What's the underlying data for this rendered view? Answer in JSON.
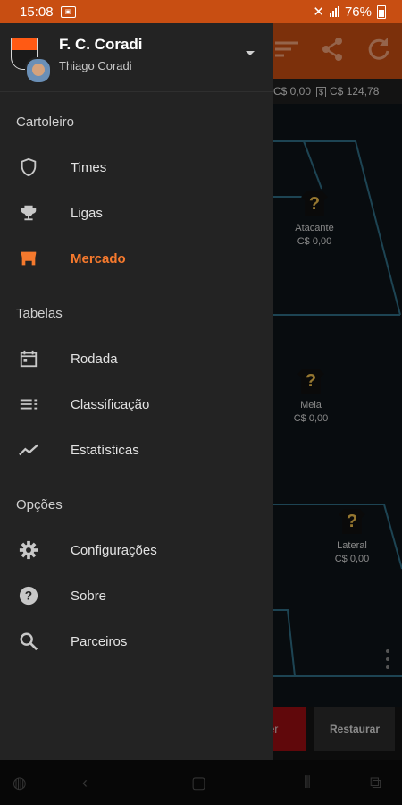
{
  "status": {
    "time": "15:08",
    "battery": "76%"
  },
  "money": {
    "left": "C$ 0,00",
    "right": "C$ 124,78",
    "right_icon": "$"
  },
  "field_players": [
    {
      "mark": "?",
      "role": "Atacante",
      "price": "C$ 0,00"
    },
    {
      "mark": "?",
      "role": "Meia",
      "price": "C$ 0,00"
    },
    {
      "mark": "?",
      "role": "Lateral",
      "price": "C$ 0,00"
    }
  ],
  "buttons": {
    "red_partial": "ler",
    "restore": "Restaurar"
  },
  "drawer": {
    "team_name": "F. C. Coradi",
    "user_name": "Thiago Coradi",
    "sections": [
      {
        "title": "Cartoleiro"
      },
      {
        "title": "Tabelas"
      },
      {
        "title": "Opções"
      }
    ],
    "items": [
      {
        "label": "Times",
        "icon": "shield-icon",
        "active": false
      },
      {
        "label": "Ligas",
        "icon": "trophy-icon",
        "active": false
      },
      {
        "label": "Mercado",
        "icon": "store-icon",
        "active": true
      },
      {
        "label": "Rodada",
        "icon": "calendar-icon",
        "active": false
      },
      {
        "label": "Classificação",
        "icon": "list-icon",
        "active": false
      },
      {
        "label": "Estatísticas",
        "icon": "trending-icon",
        "active": false
      },
      {
        "label": "Configurações",
        "icon": "gear-icon",
        "active": false
      },
      {
        "label": "Sobre",
        "icon": "help-icon",
        "active": false
      },
      {
        "label": "Parceiros",
        "icon": "search-icon",
        "active": false
      }
    ]
  },
  "colors": {
    "accent": "#c84e12",
    "active": "#f5792d",
    "drawer_bg": "#232323"
  }
}
